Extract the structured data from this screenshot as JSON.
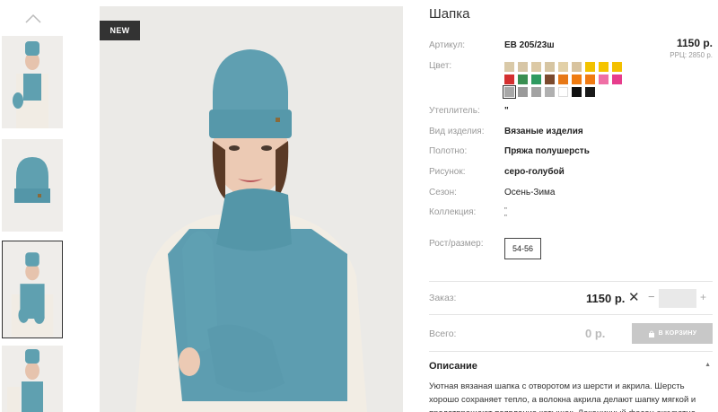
{
  "badge": "NEW",
  "product": {
    "title": "Шапка",
    "price": "1150 р.",
    "rrp": "РРЦ: 2850 р."
  },
  "labels": {
    "article": "Артикул:",
    "color": "Цвет:",
    "insulation": "Утеплитель:",
    "type": "Вид изделия:",
    "fabric": "Полотно:",
    "pattern": "Рисунок:",
    "season": "Сезон:",
    "collection": "Коллекция:",
    "size": "Рост/размер:",
    "order": "Заказ:",
    "total": "Всего:"
  },
  "values": {
    "article": "EB 205/23ш",
    "insulation": "\"",
    "type": "Вязаные изделия",
    "fabric": "Пряжа полушерсть",
    "pattern": "серо-голубой",
    "season": "Осень-Зима",
    "collection_line1": "\"",
    "collection_line2": "\""
  },
  "colors": [
    "#d9c9a8",
    "#d7c6a6",
    "#dcc9a5",
    "#d6c5a2",
    "#e2d0a7",
    "#d8c39e",
    "#f2c200",
    "#f5c400",
    "#f3c000",
    "#d43030",
    "#3a8f52",
    "#2e9a60",
    "#7b4a2e",
    "#e77817",
    "#ef7b10",
    "#f07a12",
    "#ef6fa5",
    "#e73d8c",
    "#a8a8a8",
    "#9a9a9a",
    "#a3a3a3",
    "#b0b0b0",
    "#ffffff",
    "#111111",
    "#1a1a1a"
  ],
  "selected_color_index": 18,
  "sizes": [
    "54-56"
  ],
  "order": {
    "price": "1150 р.",
    "times": "✕",
    "minus": "−",
    "plus": "+",
    "quantity": ""
  },
  "total": {
    "price": "0 р.",
    "cart_button": "В КОРЗИНУ"
  },
  "description": {
    "title": "Описание",
    "text": "Уютная вязаная шапка с отворотом из шерсти и акрила. Шерсть хорошо сохраняет тепло, а волокна акрила делают шапку мягкой и предотвращают появление катышек. Лаконичный фасон аккуратно"
  }
}
